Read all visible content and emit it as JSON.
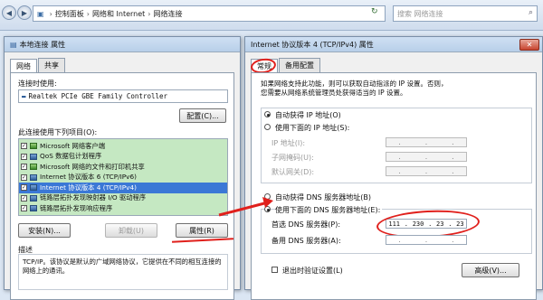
{
  "explorer": {
    "breadcrumb": [
      "控制面板",
      "网络和 Internet",
      "网络连接"
    ],
    "search_placeholder": "搜索 网络连接"
  },
  "left_dialog": {
    "title": "本地连接 属性",
    "tabs": [
      "网络",
      "共享"
    ],
    "connect_using_label": "连接时使用:",
    "adapter_name": "Realtek PCIe GBE Family Controller",
    "configure_button": "配置(C)...",
    "items_label": "此连接使用下列项目(O):",
    "items": [
      {
        "label": "Microsoft 网络客户端",
        "checked": true,
        "icon": "network-client-icon"
      },
      {
        "label": "QoS 数据包计划程序",
        "checked": true,
        "icon": "qos-icon"
      },
      {
        "label": "Microsoft 网络的文件和打印机共享",
        "checked": true,
        "icon": "file-share-icon"
      },
      {
        "label": "Internet 协议版本 6 (TCP/IPv6)",
        "checked": true,
        "icon": "protocol-icon"
      },
      {
        "label": "Internet 协议版本 4 (TCP/IPv4)",
        "checked": true,
        "icon": "protocol-icon",
        "selected": true
      },
      {
        "label": "链路层拓扑发现映射器 I/O 驱动程序",
        "checked": true,
        "icon": "protocol-icon"
      },
      {
        "label": "链路层拓扑发现响应程序",
        "checked": true,
        "icon": "protocol-icon"
      }
    ],
    "install_button": "安装(N)...",
    "uninstall_button": "卸载(U)",
    "properties_button": "属性(R)",
    "description_label": "描述",
    "description_text": "TCP/IP。该协议是默认的广域网络协议，它提供在不同的相互连接的网络上的通讯。"
  },
  "right_dialog": {
    "title": "Internet 协议版本 4 (TCP/IPv4) 属性",
    "tabs": [
      "常规",
      "备用配置"
    ],
    "info_text_1": "如果网络支持此功能，则可以获取自动指派的 IP 设置。否则，",
    "info_text_2": "您需要从网络系统管理员处获得适当的 IP 设置。",
    "auto_ip_label": "自动获得 IP 地址(O)",
    "manual_ip_label": "使用下面的 IP 地址(S):",
    "ip_address_label": "IP 地址(I):",
    "subnet_label": "子网掩码(U):",
    "gateway_label": "默认网关(D):",
    "auto_dns_label": "自动获得 DNS 服务器地址(B)",
    "manual_dns_label": "使用下面的 DNS 服务器地址(E):",
    "preferred_dns_label": "首选 DNS 服务器(P):",
    "preferred_dns": [
      "111",
      "230",
      "23",
      "23"
    ],
    "alternate_dns_label": "备用 DNS 服务器(A):",
    "validate_label": "退出时验证设置(L)",
    "advanced_button": "高级(V)..."
  },
  "colors": {
    "annotation": "#e0201c",
    "selection": "#3b78d6",
    "highlight": "#7ecd78"
  }
}
